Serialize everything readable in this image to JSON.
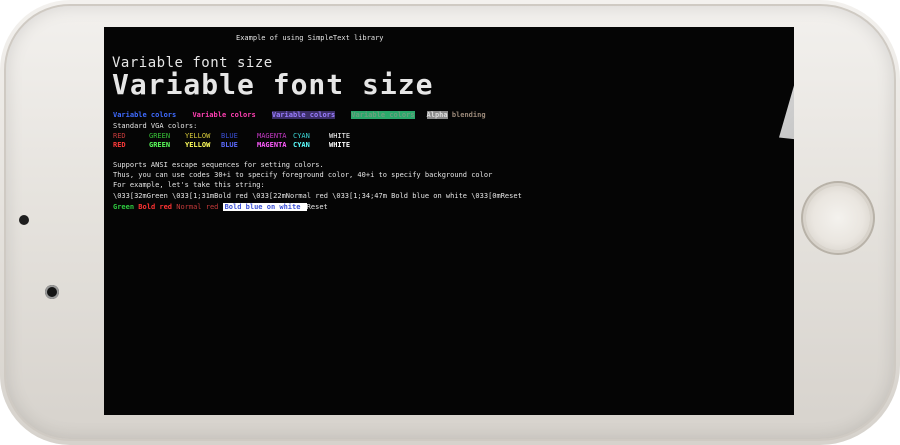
{
  "screen": {
    "title": "Example of using SimpleText library",
    "variable_font_small": "Variable font size",
    "variable_font_large": "Variable font size",
    "color_demo": {
      "blue": "Variable colors",
      "magenta": "Variable colors",
      "violet_bg": "Variable colors",
      "green_bg": "Variable colors",
      "alpha_word": "Alpha",
      "alpha_rest": " blending"
    },
    "vga_heading": "Standard VGA colors:",
    "vga_colors": [
      "RED",
      "GREEN",
      "YELLOW",
      "BLUE",
      "MAGENTA",
      "CYAN",
      "WHITE"
    ],
    "ansi_line1": "Supports ANSI escape sequences for setting colors.",
    "ansi_line2": "Thus, you can use codes 30+i to specify foreground color, 40+i to specify background color",
    "ansi_line3": "For example, let's take this string:",
    "ansi_line4": "\\033[32mGreen \\033[1;31mBold red \\033[22mNormal red \\033[1;34;47m Bold blue on white \\033[0mReset",
    "demo": {
      "green": "Green ",
      "bold_red": "Bold red ",
      "normal_red": "Normal red ",
      "bold_blue_white": " Bold blue on white ",
      "reset": "Reset"
    }
  },
  "colors": {
    "screen_bg": "#050505",
    "text": "#e6e6e6",
    "phone_body": "#e6e3de"
  }
}
